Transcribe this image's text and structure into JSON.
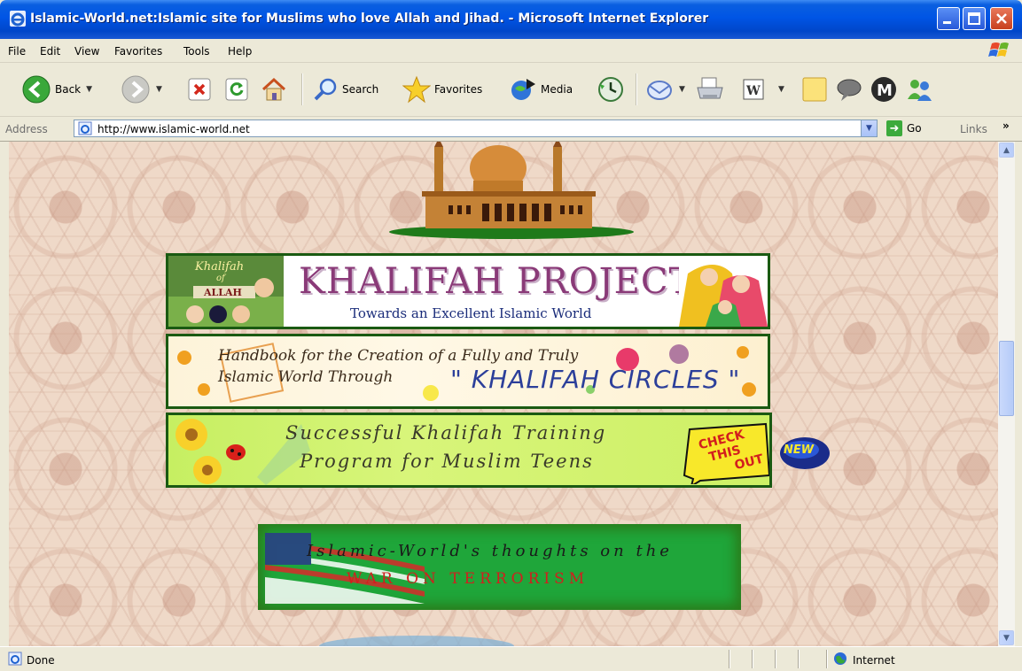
{
  "window": {
    "title": "Islamic-World.net:Islamic site for Muslims who love Allah and Jihad. - Microsoft Internet Explorer"
  },
  "menu": {
    "items": [
      "File",
      "Edit",
      "View",
      "Favorites",
      "Tools",
      "Help"
    ]
  },
  "toolbar": {
    "back_label": "Back",
    "search_label": "Search",
    "favorites_label": "Favorites",
    "media_label": "Media"
  },
  "address": {
    "label": "Address",
    "url": "http://www.islamic-world.net",
    "go_label": "Go",
    "links_label": "Links"
  },
  "page": {
    "banner1": {
      "badge_line1": "Khalifah",
      "badge_line2": "of",
      "badge_line3": "ALLAH",
      "title": "KHALIFAH PROJECT",
      "subtitle": "Towards an Excellent Islamic World"
    },
    "banner2": {
      "line1": "Handbook for the Creation of a Fully and Truly",
      "line2": "Islamic World Through",
      "circles": "\" KHALIFAH  CIRCLES \""
    },
    "banner3": {
      "line1": "Successful Khalifah Training",
      "line2": "Program for Muslim Teens",
      "cta": [
        "CHECK",
        "THIS",
        "OUT"
      ],
      "new_badge": "NEW"
    },
    "banner4": {
      "line1": "Islamic-World's thoughts on the",
      "line2": "WAR ON TERRORISM"
    }
  },
  "status": {
    "text": "Done",
    "zone": "Internet"
  }
}
